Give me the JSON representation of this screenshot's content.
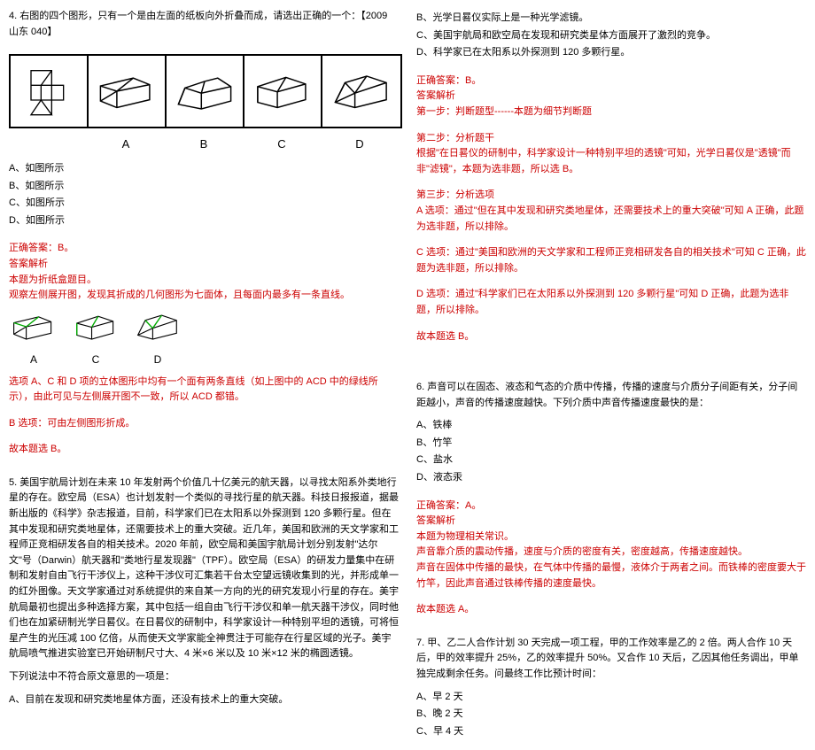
{
  "left": {
    "q4": {
      "stem": "4. 右图的四个图形，只有一个是由左面的纸板向外折叠而成，请选出正确的一个：【2009 山东 040】",
      "labels": [
        "A",
        "B",
        "C",
        "D"
      ],
      "optA": "A、如图所示",
      "optB": "B、如图所示",
      "optC": "C、如图所示",
      "optD": "D、如图所示",
      "answer": "正确答案：B。",
      "parseHeader": "答案解析",
      "parse1": "本题为折纸盒题目。",
      "parse2": "观察左侧展开图，发现其折成的几何图形为七面体，且每面内最多有一条直线。",
      "smallLabels": [
        "A",
        "C",
        "D"
      ],
      "parse3": "选项 A、C 和 D 项的立体图形中均有一个面有两条直线（如上图中的 ACD 中的绿线所示），由此可见与左侧展开图不一致，所以 ACD 都错。",
      "parse4": "B 选项：可由左侧图形折成。",
      "parse5": "故本题选 B。"
    },
    "q5": {
      "p1": "5. 美国宇航局计划在未来 10 年发射两个价值几十亿美元的航天器，以寻找太阳系外类地行星的存在。欧空局（ESA）也计划发射一个类似的寻找行星的航天器。科技日报报道，据最新出版的《科学》杂志报道，目前，科学家们已在太阳系以外探测到 120 多颗行星。但在其中发现和研究类地星体，还需要技术上的重大突破。近几年，美国和欧洲的天文学家和工程师正竞相研发各自的相关技术。2020 年前，欧空局和美国宇航局计划分别发射\"达尔文\"号（Darwin）航天器和\"类地行星发现器\"（TPF）。欧空局（ESA）的研发力量集中在研制和发射自由飞行干涉仪上，这种干涉仪可汇集若干台太空望远镜收集到的光，并形成单一的红外图像。天文学家通过对系统提供的来自某一方向的光的研究发现小行星的存在。美宇航局最初也提出多种选择方案，其中包括一组自由飞行干涉仪和单一航天器干涉仪，同时他们也在加紧研制光学日晷仪。在日晷仪的研制中，科学家设计一种特别平坦的透镜，可将恒星产生的光压减 100 亿倍，从而使天文学家能全神贯注于可能存在行星区域的光子。美宇航局喷气推进实验室已开始研制尺寸大、4 米×6 米以及 10 米×12 米的椭圆透镜。",
      "p2": "下列说法中不符合原文意思的一项是：",
      "optA": "A、目前在发现和研究类地星体方面，还没有技术上的重大突破。"
    }
  },
  "right": {
    "q5cont": {
      "optB": "B、光学日晷仪实际上是一种光学滤镜。",
      "optC": "C、美国宇航局和欧空局在发现和研究类星体方面展开了激烈的竞争。",
      "optD": "D、科学家已在太阳系以外探测到 120 多颗行星。",
      "answer": "正确答案：B。",
      "parseHeader": "答案解析",
      "step1": "第一步：判断题型------本题为细节判断题",
      "step2": "第二步：分析题干",
      "step2b": "根据\"在日晷仪的研制中，科学家设计一种特别平坦的透镜\"可知，光学日晷仪是\"透镜\"而非\"滤镜\"，本题为选非题，所以选 B。",
      "step3": "第三步：分析选项",
      "optAParse": "A 选项：通过\"但在其中发现和研究类地星体，还需要技术上的重大突破\"可知 A 正确，此题为选非题，所以排除。",
      "optCParse": "C 选项：通过\"美国和欧洲的天文学家和工程师正竞相研发各自的相关技术\"可知 C 正确，此题为选非题，所以排除。",
      "optDParse": "D 选项：通过\"科学家们已在太阳系以外探测到 120 多颗行星\"可知 D 正确，此题为选非题，所以排除。",
      "concl": "故本题选 B。"
    },
    "q6": {
      "stem": "6. 声音可以在固态、液态和气态的介质中传播，传播的速度与介质分子间距有关，分子间距越小，声音的传播速度越快。下列介质中声音传播速度最快的是：",
      "optA": "A、铁棒",
      "optB": "B、竹竿",
      "optC": "C、盐水",
      "optD": "D、液态汞",
      "answer": "正确答案：A。",
      "parseHeader": "答案解析",
      "parse1": "本题为物理相关常识。",
      "parse2": "声音靠介质的震动传播，速度与介质的密度有关，密度越高，传播速度越快。",
      "parse3": "声音在固体中传播的最快，在气体中传播的最慢，液体介于两者之间。而铁棒的密度要大于竹竿，因此声音通过铁棒传播的速度最快。",
      "concl": "故本题选 A。"
    },
    "q7": {
      "stem": "7. 甲、乙二人合作计划 30 天完成一项工程，甲的工作效率是乙的 2 倍。两人合作 10 天后，甲的效率提升 25%，乙的效率提升 50%。又合作 10 天后，乙因其他任务调出，甲单独完成剩余任务。问最终工作比预计时间：",
      "optA": "A、早 2 天",
      "optB": "B、晚 2 天",
      "optC": "C、早 4 天"
    }
  }
}
